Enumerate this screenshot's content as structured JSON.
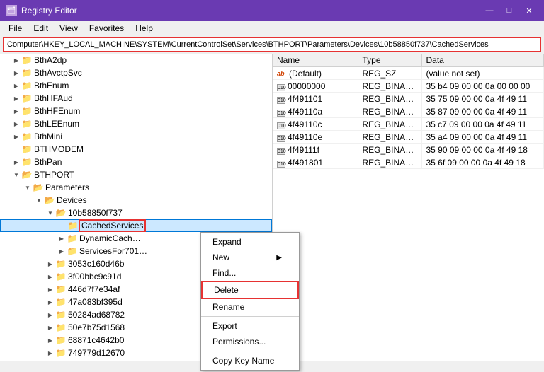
{
  "titleBar": {
    "icon": "🗂",
    "title": "Registry Editor",
    "minimizeLabel": "—",
    "maximizeLabel": "□",
    "closeLabel": "✕"
  },
  "menuBar": {
    "items": [
      "File",
      "Edit",
      "View",
      "Favorites",
      "Help"
    ]
  },
  "addressBar": {
    "path": "Computer\\HKEY_LOCAL_MACHINE\\SYSTEM\\CurrentControlSet\\Services\\BTHPORT\\Parameters\\Devices\\10b58850f737\\CachedServices"
  },
  "tree": {
    "items": [
      {
        "indent": 1,
        "arrow": "▶",
        "label": "BthA2dp",
        "hasArrow": true
      },
      {
        "indent": 1,
        "arrow": "▶",
        "label": "BthAvctpSvc",
        "hasArrow": true
      },
      {
        "indent": 1,
        "arrow": "▶",
        "label": "BthEnum",
        "hasArrow": true
      },
      {
        "indent": 1,
        "arrow": "▶",
        "label": "BthHFAud",
        "hasArrow": true
      },
      {
        "indent": 1,
        "arrow": "▶",
        "label": "BthHFEnum",
        "hasArrow": true
      },
      {
        "indent": 1,
        "arrow": "▶",
        "label": "BthLEEnum",
        "hasArrow": true
      },
      {
        "indent": 1,
        "arrow": "▶",
        "label": "BthMini",
        "hasArrow": true
      },
      {
        "indent": 1,
        "arrow": " ",
        "label": "BTHMODEM",
        "hasArrow": false
      },
      {
        "indent": 1,
        "arrow": "▶",
        "label": "BthPan",
        "hasArrow": true
      },
      {
        "indent": 1,
        "arrow": "▼",
        "label": "BTHPORT",
        "hasArrow": true,
        "expanded": true
      },
      {
        "indent": 2,
        "arrow": "▼",
        "label": "Parameters",
        "hasArrow": true,
        "expanded": true
      },
      {
        "indent": 3,
        "arrow": "▼",
        "label": "Devices",
        "hasArrow": true,
        "expanded": true
      },
      {
        "indent": 4,
        "arrow": "▼",
        "label": "10b58850f737",
        "hasArrow": true,
        "expanded": true
      },
      {
        "indent": 5,
        "arrow": " ",
        "label": "CachedServices",
        "hasArrow": false,
        "selected": true
      },
      {
        "indent": 5,
        "arrow": "▶",
        "label": "DynamicCach…",
        "hasArrow": true
      },
      {
        "indent": 5,
        "arrow": "▶",
        "label": "ServicesFor701…",
        "hasArrow": true
      },
      {
        "indent": 4,
        "arrow": "▶",
        "label": "3053c160d46b",
        "hasArrow": true
      },
      {
        "indent": 4,
        "arrow": "▶",
        "label": "3f00bbc9c91d",
        "hasArrow": true
      },
      {
        "indent": 4,
        "arrow": "▶",
        "label": "446d7f7e34af",
        "hasArrow": true
      },
      {
        "indent": 4,
        "arrow": "▶",
        "label": "47a083bf395d",
        "hasArrow": true
      },
      {
        "indent": 4,
        "arrow": "▶",
        "label": "50284ad68782",
        "hasArrow": true
      },
      {
        "indent": 4,
        "arrow": "▶",
        "label": "50e7b75d1568",
        "hasArrow": true
      },
      {
        "indent": 4,
        "arrow": "▶",
        "label": "68871c4642b0",
        "hasArrow": true
      },
      {
        "indent": 4,
        "arrow": "▶",
        "label": "749779d12670",
        "hasArrow": true
      }
    ]
  },
  "registryTable": {
    "columns": [
      "Name",
      "Type",
      "Data"
    ],
    "rows": [
      {
        "name": "(Default)",
        "icon": "ab",
        "type": "REG_SZ",
        "data": "(value not set)"
      },
      {
        "name": "00000000",
        "icon": "bin",
        "type": "REG_BINARY",
        "data": "35 b4 09 00 00 0a 00 00 00"
      },
      {
        "name": "4f491101",
        "icon": "bin",
        "type": "REG_BINARY",
        "data": "35 75 09 00 00 0a 4f 49 11"
      },
      {
        "name": "4f49110a",
        "icon": "bin",
        "type": "REG_BINARY",
        "data": "35 87 09 00 00 0a 4f 49 11"
      },
      {
        "name": "4f49110c",
        "icon": "bin",
        "type": "REG_BINARY",
        "data": "35 c7 09 00 00 0a 4f 49 11"
      },
      {
        "name": "4f49110e",
        "icon": "bin",
        "type": "REG_BINARY",
        "data": "35 a4 09 00 00 0a 4f 49 11"
      },
      {
        "name": "4f49111f",
        "icon": "bin",
        "type": "REG_BINARY",
        "data": "35 90 09 00 00 0a 4f 49 18"
      },
      {
        "name": "4f491801",
        "icon": "bin",
        "type": "REG_BINARY",
        "data": "35 6f 09 00 00 0a 4f 49 18"
      }
    ]
  },
  "contextMenu": {
    "items": [
      {
        "label": "Expand",
        "id": "expand",
        "hasSub": false,
        "separator": false
      },
      {
        "label": "New",
        "id": "new",
        "hasSub": true,
        "separator": false
      },
      {
        "label": "Find...",
        "id": "find",
        "hasSub": false,
        "separator": false
      },
      {
        "label": "Delete",
        "id": "delete",
        "hasSub": false,
        "separator": false,
        "highlighted": true
      },
      {
        "label": "Rename",
        "id": "rename",
        "hasSub": false,
        "separator": false
      },
      {
        "separator": true
      },
      {
        "label": "Export",
        "id": "export",
        "hasSub": false,
        "separator": false
      },
      {
        "label": "Permissions...",
        "id": "permissions",
        "hasSub": false,
        "separator": false
      },
      {
        "separator": true
      },
      {
        "label": "Copy Key Name",
        "id": "copy-key-name",
        "hasSub": false,
        "separator": false
      }
    ]
  },
  "statusBar": {
    "text": ""
  }
}
